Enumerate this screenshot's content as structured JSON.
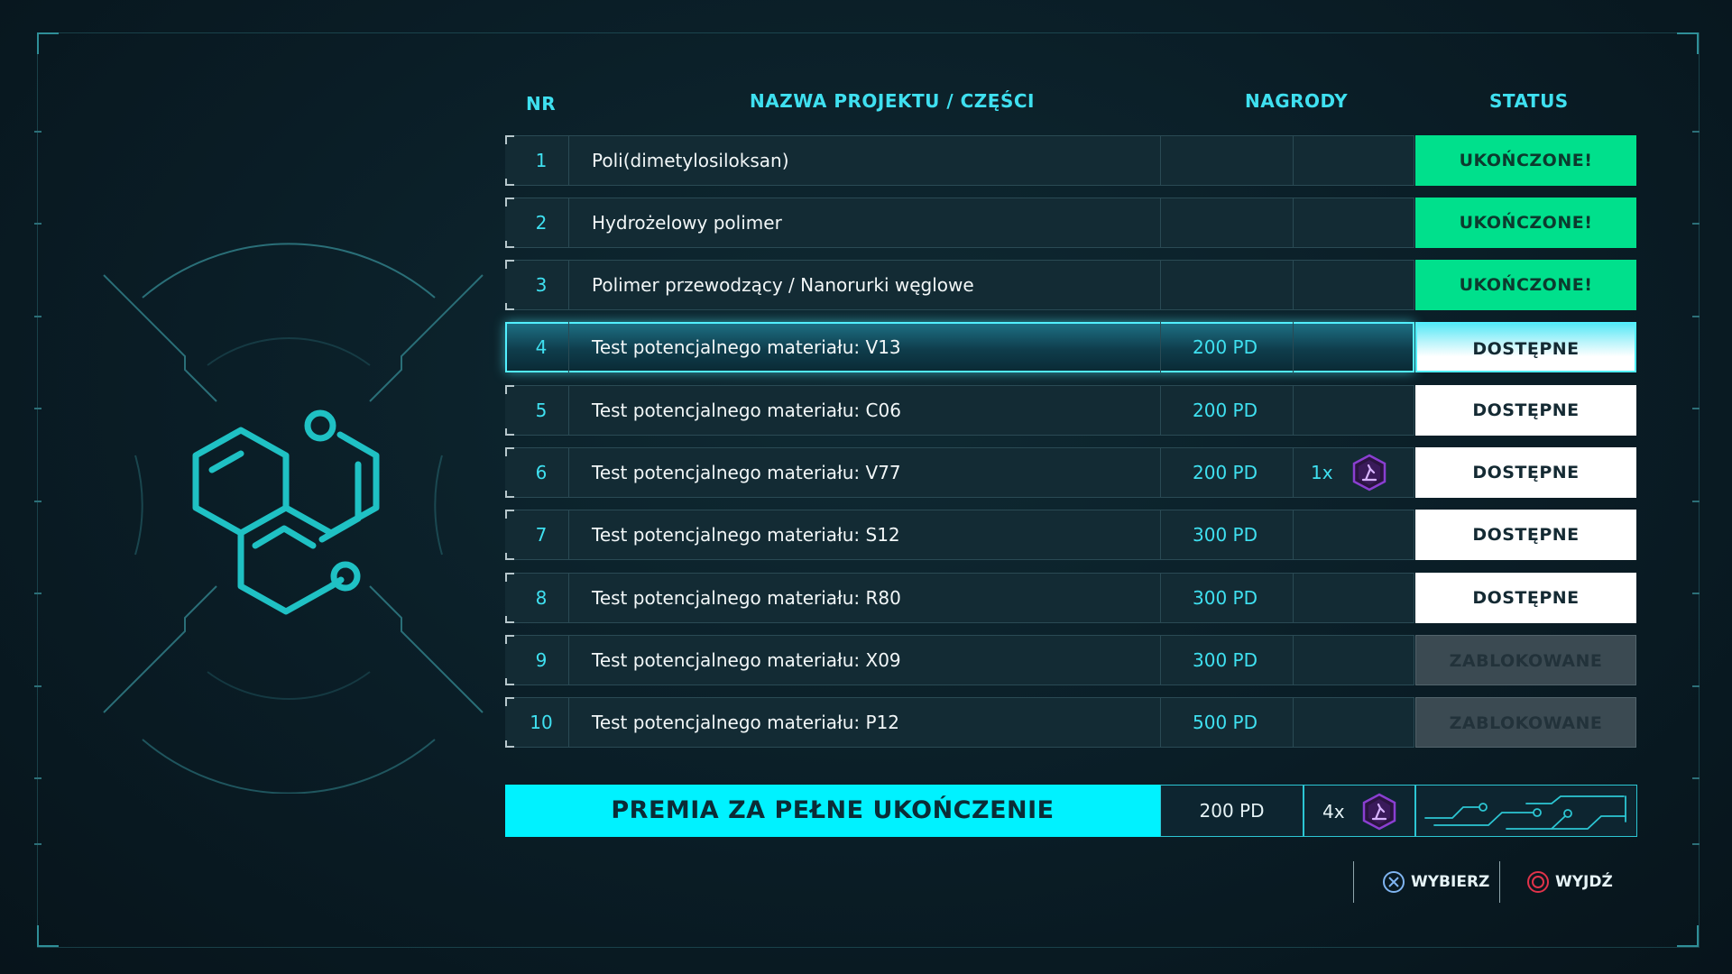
{
  "headers": {
    "nr": "NR",
    "name": "NAZWA PROJEKTU / CZĘŚCI",
    "rewards": "NAGRODY",
    "status": "STATUS"
  },
  "rows": [
    {
      "nr": "1",
      "name": "Poli(dimetylosiloksan)",
      "pd": "",
      "reward_qty": "",
      "reward_icon": "",
      "status": "UKOŃCZONE!",
      "state": "done"
    },
    {
      "nr": "2",
      "name": "Hydrożelowy polimer",
      "pd": "",
      "reward_qty": "",
      "reward_icon": "",
      "status": "UKOŃCZONE!",
      "state": "done"
    },
    {
      "nr": "3",
      "name": "Polimer przewodzący / Nanorurki węglowe",
      "pd": "",
      "reward_qty": "",
      "reward_icon": "",
      "status": "UKOŃCZONE!",
      "state": "done"
    },
    {
      "nr": "4",
      "name": "Test potencjalnego materiału: V13",
      "pd": "200 PD",
      "reward_qty": "",
      "reward_icon": "",
      "status": "DOSTĘPNE",
      "state": "available",
      "selected": true
    },
    {
      "nr": "5",
      "name": "Test potencjalnego materiału: C06",
      "pd": "200 PD",
      "reward_qty": "",
      "reward_icon": "",
      "status": "DOSTĘPNE",
      "state": "available"
    },
    {
      "nr": "6",
      "name": "Test potencjalnego materiału: V77",
      "pd": "200 PD",
      "reward_qty": "1x",
      "reward_icon": "research-token-icon",
      "status": "DOSTĘPNE",
      "state": "available"
    },
    {
      "nr": "7",
      "name": "Test potencjalnego materiału: S12",
      "pd": "300 PD",
      "reward_qty": "",
      "reward_icon": "",
      "status": "DOSTĘPNE",
      "state": "available"
    },
    {
      "nr": "8",
      "name": "Test potencjalnego materiału: R80",
      "pd": "300 PD",
      "reward_qty": "",
      "reward_icon": "",
      "status": "DOSTĘPNE",
      "state": "available"
    },
    {
      "nr": "9",
      "name": "Test potencjalnego materiału: X09",
      "pd": "300 PD",
      "reward_qty": "",
      "reward_icon": "",
      "status": "ZABLOKOWANE",
      "state": "locked"
    },
    {
      "nr": "10",
      "name": "Test potencjalnego materiału: P12",
      "pd": "500 PD",
      "reward_qty": "",
      "reward_icon": "",
      "status": "ZABLOKOWANE",
      "state": "locked"
    }
  ],
  "bonus": {
    "title": "PREMIA ZA PEŁNE UKOŃCZENIE",
    "pd": "200 PD",
    "reward_qty": "4x",
    "reward_icon": "research-token-icon"
  },
  "controls": {
    "select_label": "WYBIERZ",
    "exit_label": "WYJDŹ"
  },
  "colors": {
    "accent": "#3fe0f0",
    "done": "#00e08c",
    "available": "#ffffff",
    "locked": "#3b4a52",
    "bonus": "#00f2ff",
    "token": "#8a3fd1"
  }
}
